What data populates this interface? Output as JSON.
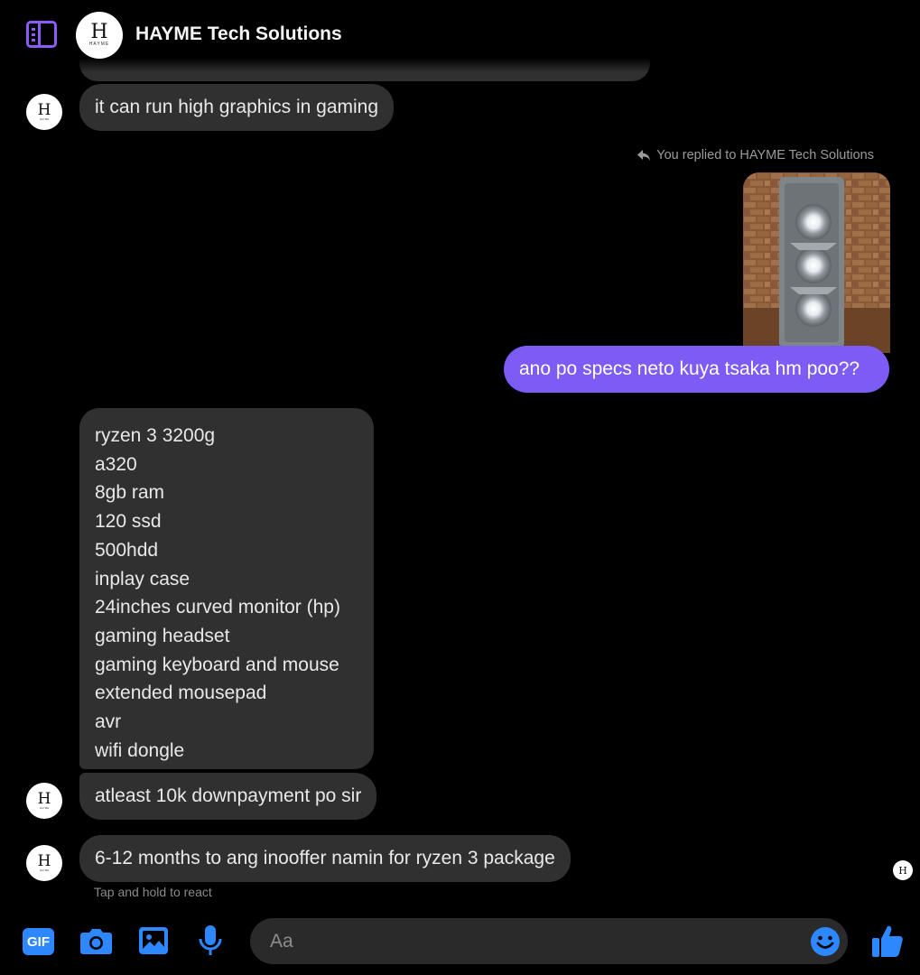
{
  "header": {
    "title": "HAYME Tech Solutions",
    "avatar_mark": "H",
    "avatar_sub": "HAYME"
  },
  "messages": {
    "first_received": "it can run high graphics in gaming",
    "reply_label": "You replied to HAYME Tech Solutions",
    "sent_text": "ano po specs neto kuya tsaka hm poo??",
    "specs": [
      "ryzen 3 3200g",
      "a320",
      "8gb ram",
      "120 ssd",
      "500hdd",
      "inplay case",
      "24inches curved monitor (hp)",
      "gaming headset",
      "gaming keyboard and mouse",
      "extended mousepad",
      "avr",
      "wifi dongle"
    ],
    "downpayment": "atleast 10k downpayment po sir",
    "months_offer": "6-12 months to ang inooffer namin for ryzen 3 package",
    "react_hint": "Tap and hold to react"
  },
  "composer": {
    "gif_label": "GIF",
    "placeholder": "Aa"
  },
  "colors": {
    "accent": "#7c5cf5",
    "bubble_received": "#303030",
    "icon_blue": "#2d88ff",
    "sidebar_purple": "#8b5cf6"
  },
  "icons": [
    "sidebar-toggle-icon",
    "reply-arrow-icon",
    "camera-icon",
    "image-icon",
    "microphone-icon",
    "emoji-icon",
    "thumbs-up-icon"
  ]
}
